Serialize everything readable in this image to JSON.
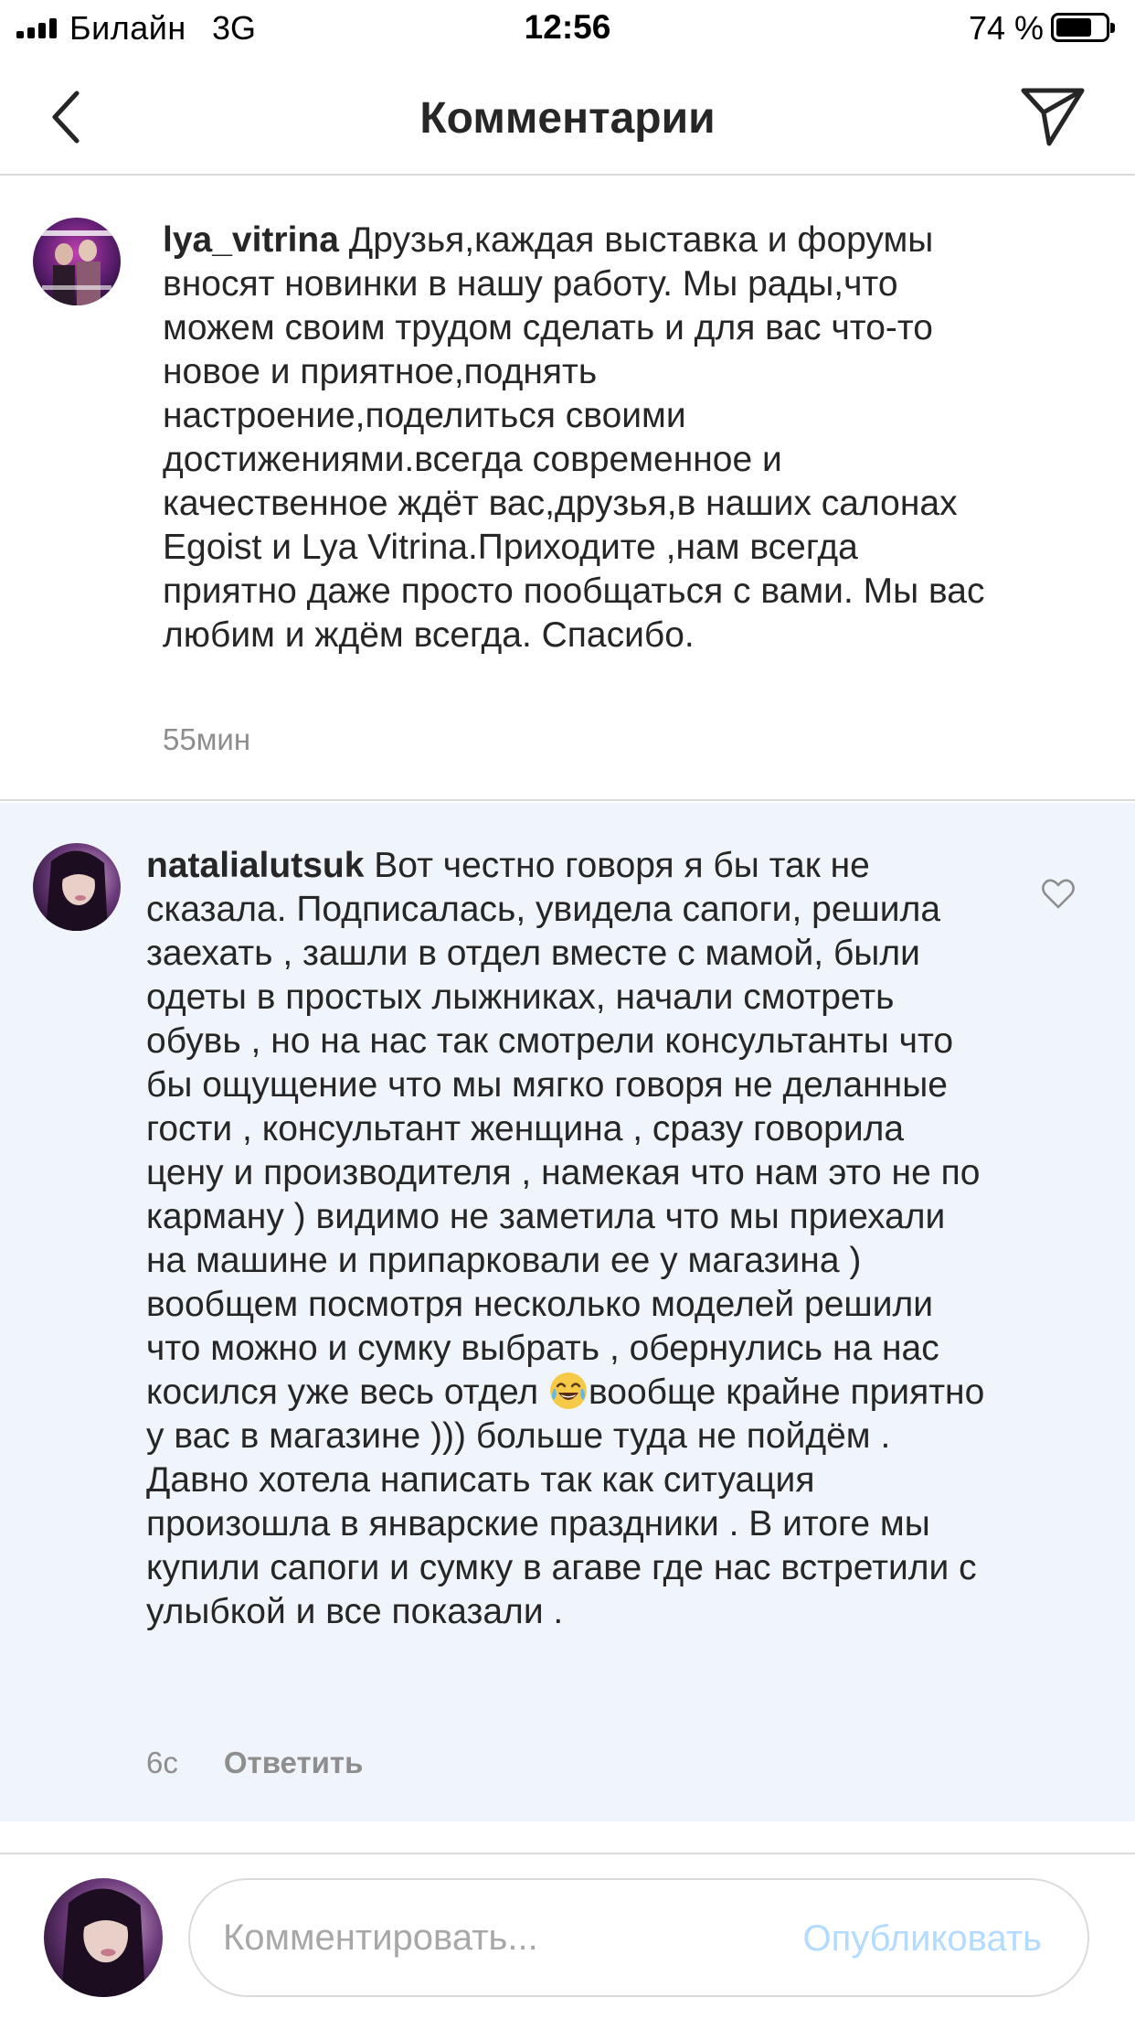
{
  "status_bar": {
    "carrier": "Билайн",
    "network": "3G",
    "time": "12:56",
    "battery_percent_label": "74 %",
    "battery_level": 0.74,
    "signal_bars": 4
  },
  "header": {
    "title": "Комментарии",
    "back_icon": "chevron-left-icon",
    "share_icon": "paper-plane-icon"
  },
  "comments": [
    {
      "username": "lya_vitrina",
      "text": "Друзья,каждая выставка и форумы вносят новинки в нашу работу. Мы рады,что можем своим трудом сделать и для вас что-то новое и приятное,поднять настроение,поделиться своими достижениями.всегда современное и качественное ждёт вас,друзья,в наших салонах Egoist и Lya Vitrina.Приходите ,нам всегда приятно  даже просто пообщаться с вами. Мы вас любим и ждём всегда. Спасибо.",
      "time": "55мин"
    },
    {
      "username": "natalialutsuk",
      "text_before_emoji": "Вот честно говоря я бы так не сказала. Подписалась, увидела сапоги, решила заехать , зашли в отдел вместе с мамой, были одеты в простых лыжниках, начали смотреть обувь , но на нас так смотрели консультанты что бы ощущение что мы мягко говоря не деланные гости , консультант женщина , сразу говорила цену и производителя , намекая что нам это не по карману ) видимо не заметила что мы приехали на машине и припарковали ее у магазина ) вообщем посмотря несколько моделей решили что можно и сумку выбрать , обернулись на нас косился уже весь отдел ",
      "emoji": "tears-of-joy-emoji",
      "text_after_emoji": "вообще крайне приятно у вас в магазине ))) больше туда не пойдём . Давно хотела написать так как ситуация произошла в январские праздники . В итоге мы купили сапоги и сумку в агаве где нас встретили с улыбкой и все показали .",
      "time": "6с",
      "reply_label": "Ответить",
      "like_icon": "heart-outline-icon"
    }
  ],
  "composer": {
    "placeholder": "Комментировать...",
    "value": "",
    "publish_label": "Опубликовать"
  },
  "colors": {
    "highlight_bg": "#eff5fb",
    "divider": "#dbdbdb",
    "muted_text": "#8e8e8e",
    "publish_disabled": "#b3dbff"
  }
}
